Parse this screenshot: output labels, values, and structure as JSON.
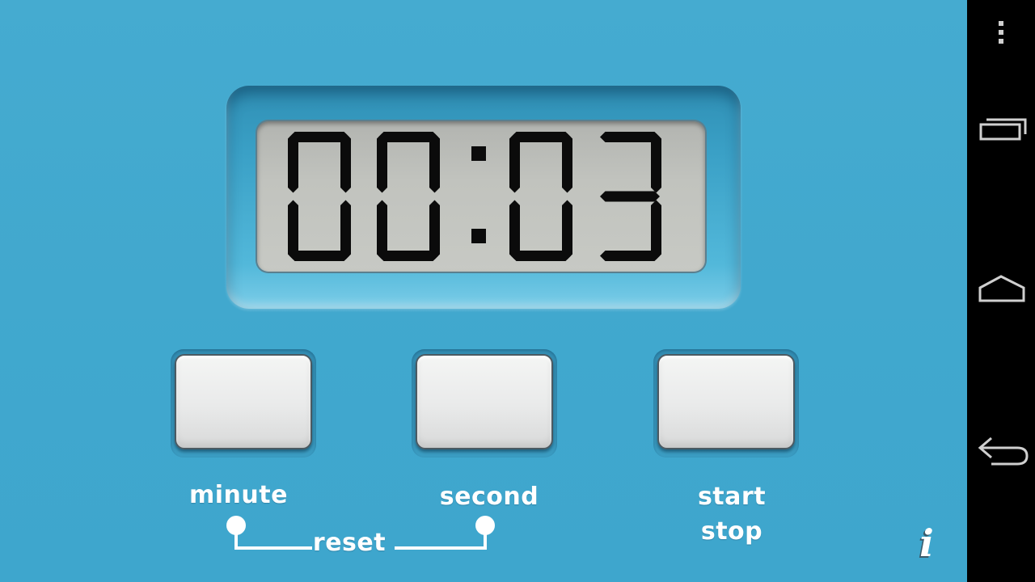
{
  "display": {
    "time": "00:03",
    "minutes": "00",
    "seconds": "03"
  },
  "controls": {
    "minute_label": "minute",
    "second_label": "second",
    "start_label": "start",
    "stop_label": "stop",
    "reset_label": "reset"
  },
  "info_glyph": "i",
  "colors": {
    "body": "#42a9cf",
    "lcd_background": "#c1c3be",
    "lcd_segment": "#0b0b0b",
    "button_face": "#ecedec",
    "label_text": "#ffffff",
    "nav_bar": "#000000"
  },
  "icons": {
    "info": "info-icon",
    "overflow_menu": "overflow-menu-icon",
    "recents": "recents-icon",
    "home": "home-icon",
    "back": "back-icon"
  }
}
